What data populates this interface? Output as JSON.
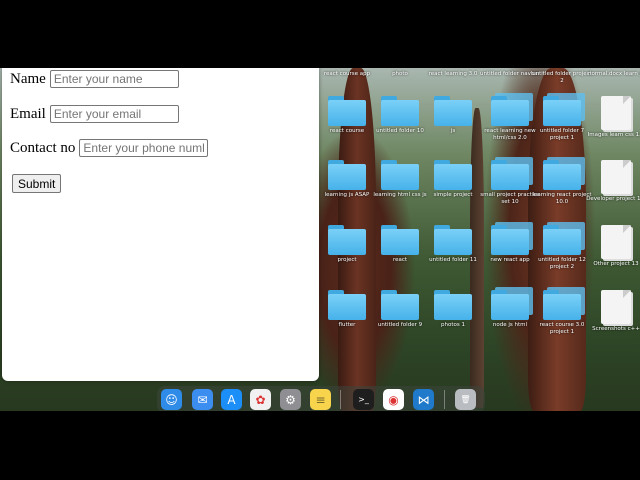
{
  "form": {
    "name_label": "Name",
    "name_placeholder": "Enter your name",
    "email_label": "Email",
    "email_placeholder": "Enter your email",
    "contact_label": "Contact no",
    "contact_placeholder": "Enter your phone numb",
    "submit_label": "Submit"
  },
  "desktop": {
    "top_row": [
      "react course app",
      "photo",
      "react learning 3.0",
      "untitled folder navbar",
      "untitled folder project 2",
      "normal.docx learn js"
    ],
    "rows": [
      [
        "react course",
        "untitled folder 10",
        "js",
        "react learning new html/css 2.0",
        "untitled folder 7 project 1",
        "Images learn css 1.0"
      ],
      [
        "learning js ASAP",
        "learning html css js",
        "simple project",
        "small project practice set 10",
        "learning react project 10.0",
        "Developer project 1.0"
      ],
      [
        "project",
        "react",
        "untitled folder 11",
        "new react app",
        "untitled folder 12 project 2",
        "Other project 13"
      ],
      [
        "flutter",
        "untitled folder 9",
        "photos 1",
        "node js html",
        "react course 3.0 project 1",
        "Screenshots c++"
      ]
    ]
  },
  "dock": {
    "apps": [
      {
        "name": "finder-icon",
        "color": "#2f8be8",
        "glyph": "☺"
      },
      {
        "name": "mail-icon",
        "color": "#3c8df0",
        "glyph": "✉"
      },
      {
        "name": "app-store-icon",
        "color": "#1c8ef7",
        "glyph": "A"
      },
      {
        "name": "photos-icon",
        "color": "#f1f1f1",
        "glyph": "✿"
      },
      {
        "name": "system-preferences-icon",
        "color": "#8e8e93",
        "glyph": "⚙"
      },
      {
        "name": "notes-icon",
        "color": "#f7d44c",
        "glyph": "≡"
      },
      {
        "name": "terminal-icon",
        "color": "#1e1e1e",
        "glyph": ">_"
      },
      {
        "name": "chrome-icon",
        "color": "#ffffff",
        "glyph": "◉"
      },
      {
        "name": "vscode-icon",
        "color": "#1f7acb",
        "glyph": "⋈"
      },
      {
        "name": "trash-icon",
        "color": "#b9bcc0",
        "glyph": "🗑"
      }
    ]
  }
}
